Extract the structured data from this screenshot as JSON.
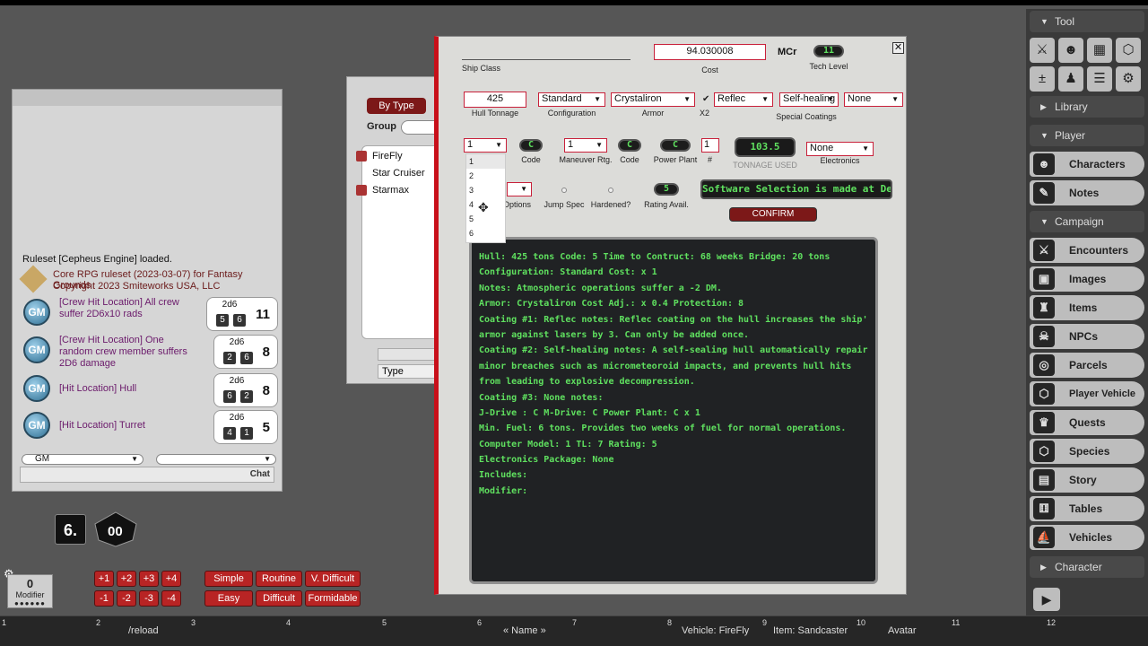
{
  "chat": {
    "ruleset_loaded": "Ruleset [Cepheus Engine] loaded.",
    "core_line1": "Core RPG ruleset (2023-03-07) for Fantasy Grounds",
    "core_line2": "Copyright 2023 Smiteworks USA, LLC",
    "gm_icon_label": "GM",
    "rolls": [
      {
        "text": "[Crew Hit Location] All crew suffer 2D6x10 rads",
        "dice_label": "2d6",
        "dice": [
          "5",
          "6"
        ],
        "total": "11"
      },
      {
        "text": "[Crew Hit Location] One random crew member suffers 2D6 damage",
        "dice_label": "2d6",
        "dice": [
          "2",
          "6"
        ],
        "total": "8"
      },
      {
        "text": "[Hit Location] Hull",
        "dice_label": "2d6",
        "dice": [
          "6",
          "2"
        ],
        "total": "8"
      },
      {
        "text": "[Hit Location] Turret",
        "dice_label": "2d6",
        "dice": [
          "4",
          "1"
        ],
        "total": "5"
      }
    ],
    "identity_select": "GM",
    "language_select": "",
    "chat_button": "Chat"
  },
  "vehicle_list": {
    "by_type_button": "By Type",
    "group_label": "Group",
    "items": [
      "FireFly",
      "Star Cruiser",
      "Starmax"
    ],
    "type_field": "Type"
  },
  "ship": {
    "ship_class_label": "Ship Class",
    "cost_value": "94.030008",
    "cost_label": "Cost",
    "mcr_label": "MCr",
    "tech_level_value": "11",
    "tech_level_label": "Tech Level",
    "hull_tonnage_value": "425",
    "hull_tonnage_label": "Hull Tonnage",
    "configuration_value": "Standard",
    "configuration_label": "Configuration",
    "armor_value": "Crystaliron",
    "armor_label": "Armor",
    "x2_label": "X2",
    "coating1": "Reflec",
    "coating2": "Self-healing",
    "coating3": "None",
    "special_coatings_label": "Special Coatings",
    "jump_select": "1",
    "jump_code_value": "C",
    "code_label": "Code",
    "maneuver_value": "1",
    "maneuver_label": "Maneuver Rtg.",
    "maneuver_code_value": "C",
    "power_plant_value": "C",
    "power_plant_label": "Power Plant",
    "pp_count_value": "1",
    "pp_count_label": "#",
    "tonnage_used_value": "103.5",
    "tonnage_used_label": "TONNAGE USED",
    "electronics_value": "None",
    "electronics_label": "Electronics",
    "options_label": "Options",
    "jump_spec_label": "Jump Spec",
    "hardened_label": "Hardened?",
    "rating_value": "5",
    "rating_label": "Rating Avail.",
    "software_text": "Software Selection is made at Delivery",
    "confirm_button": "CONFIRM",
    "dropdown_options": [
      "1",
      "2",
      "3",
      "4",
      "5",
      "6"
    ],
    "terminal_lines": [
      "Hull: 425 tons  Code: 5  Time to Contruct: 68 weeks  Bridge: 20 tons",
      "Configuration: Standard  Cost: x 1",
      "   Notes: Atmospheric operations suffer a -2 DM.",
      "Armor: Crystaliron  Cost Adj.: x 0.4  Protection: 8",
      "   Coating #1: Reflec notes: Reflec coating on the hull increases the ship's",
      "armor against lasers by 3. Can only be added once.",
      "   Coating #2: Self-healing notes: A self-sealing hull automatically repairs",
      "minor breaches such as micrometeoroid impacts, and prevents hull hits",
      "from leading to explosive decompression.",
      "   Coating #3: None notes:",
      "J-Drive : C  M-Drive: C  Power Plant: C x 1",
      "   Min. Fuel: 6 tons. Provides two weeks of fuel for normal operations.",
      "Computer Model: 1  TL: 7  Rating: 5",
      "Electronics Package: None",
      "   Includes:",
      "   Modifier:"
    ]
  },
  "sidebar": {
    "tool_label": "Tool",
    "library_label": "Library",
    "player_label": "Player",
    "player_items": [
      "Characters",
      "Notes"
    ],
    "campaign_label": "Campaign",
    "campaign_items": [
      "Encounters",
      "Images",
      "Items",
      "NPCs",
      "Parcels",
      "Player Vehicle",
      "Quests",
      "Species",
      "Story",
      "Tables",
      "Vehicles"
    ],
    "character_label": "Character"
  },
  "dice": {
    "d6_label": "6.",
    "d100_label": "00"
  },
  "modifier": {
    "value": "0",
    "label": "Modifier"
  },
  "mod_buttons": [
    "+1",
    "+2",
    "+3",
    "+4",
    "-1",
    "-2",
    "-3",
    "-4"
  ],
  "difficulty_buttons": [
    "Simple",
    "Routine",
    "V. Difficult",
    "Easy",
    "Difficult",
    "Formidable"
  ],
  "hotkeys": {
    "numbers": [
      "1",
      "2",
      "3",
      "4",
      "5",
      "6",
      "7",
      "8",
      "9",
      "10",
      "11",
      "12"
    ],
    "reload": "/reload",
    "name": "« Name »",
    "vehicle": "Vehicle: FireFly",
    "item": "Item: Sandcaster",
    "avatar": "Avatar"
  },
  "colors": {
    "accent_red": "#c8101a",
    "terminal_green": "#5fe05f",
    "button_red": "#b82424"
  }
}
